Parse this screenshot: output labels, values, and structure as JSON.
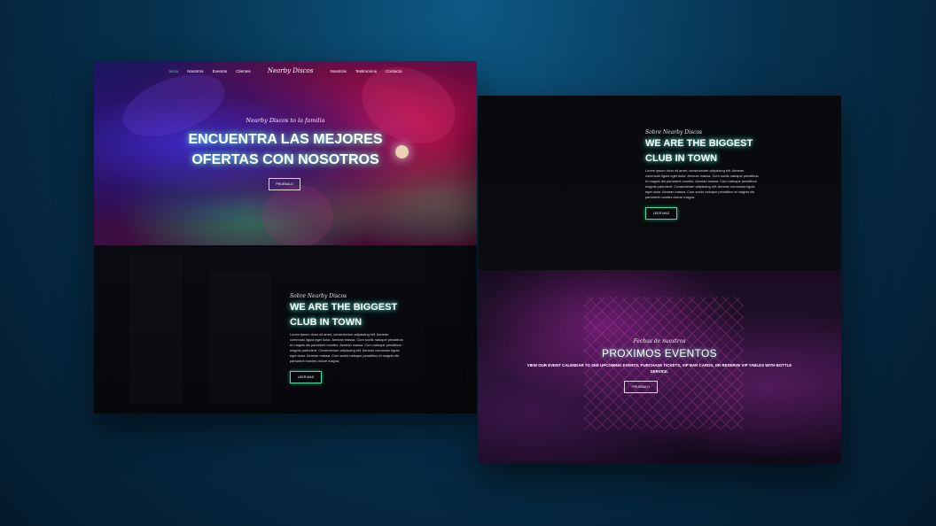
{
  "nav": {
    "items_left": [
      "Inicio",
      "Nosotros",
      "Eventos",
      "Clientes"
    ],
    "logo": "Nearby Discos",
    "items_right": [
      "Nosotros",
      "Testimonios",
      "Contacto"
    ]
  },
  "hero": {
    "tagline": "Nearby Discos to la familia",
    "title_line1": "ENCUENTRA LAS MEJORES",
    "title_line2": "OFERTAS CON NOSOTROS",
    "button": "PRUEBALO"
  },
  "about": {
    "tagline": "Sobre Nearby Discos",
    "title_line1": "WE ARE THE BIGGEST",
    "title_line2": "CLUB IN TOWN",
    "body": "Lorem ipsum dolor sit amet, consectetuer adipiscing elit. Aenean commodo ligula eget dolor. Aenean massa. Cum sociis natoque penatibus et magnis dis parturient montes. Aenean massa. Cum natoque penatibus magnis parturient. Consectetuer adipiscing elit. Aenean commodo ligula eget dolor. Aenean massa. Cum sociis natoque penatibus et magnis dis parturient montes dolore magna.",
    "button": "LEER MAS"
  },
  "events": {
    "tagline": "Fechas de nuestros",
    "title": "PROXIMOS EVENTOS",
    "description": "VIEW OUR EVENT CALENDAR TO SEE UPCOMING EVENTS, PURCHASE TICKETS, VIP BAR CARDS, OR RESERVE VIP TABLES WITH BOTTLE SERVICE.",
    "button": "PRUEBALO"
  },
  "colors": {
    "accent_green": "#3ee08f",
    "glow_teal": "#78ffdc",
    "background_blue": "#07324f"
  }
}
